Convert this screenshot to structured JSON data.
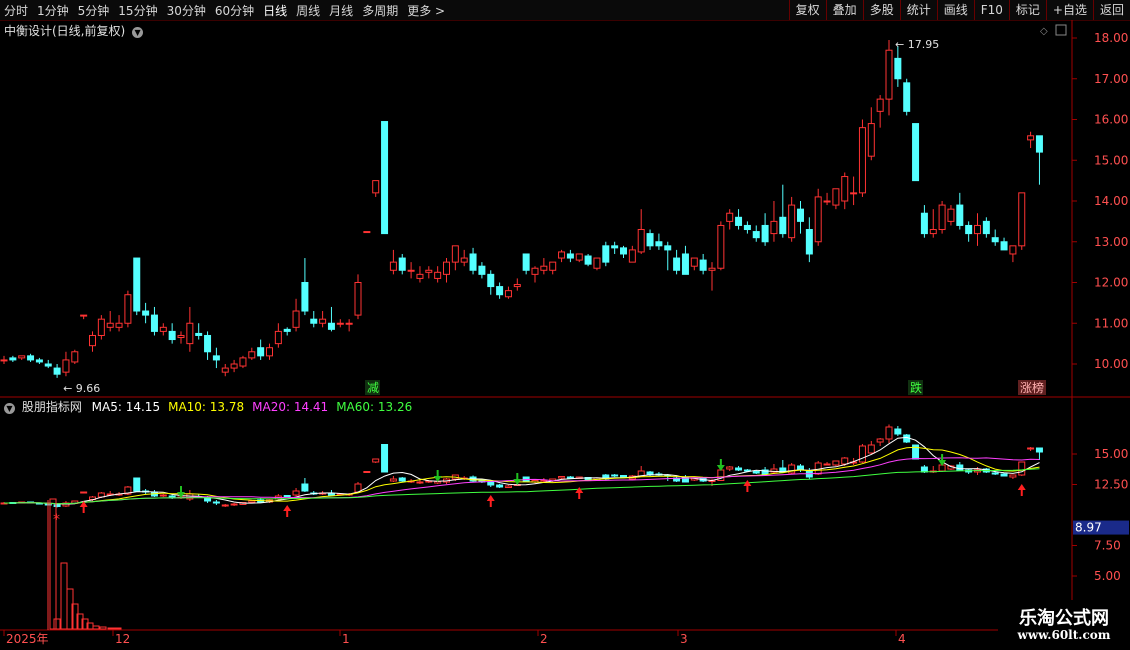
{
  "toolbar": {
    "periods": [
      "分时",
      "1分钟",
      "5分钟",
      "15分钟",
      "30分钟",
      "60分钟",
      "日线",
      "周线",
      "月线",
      "多周期",
      "更多 >"
    ],
    "active_period": "日线",
    "actions": [
      "复权",
      "叠加",
      "多股",
      "统计",
      "画线",
      "F10",
      "标记",
      "+自选",
      "返回"
    ]
  },
  "stock": {
    "title": "中衡设计(日线,前复权)"
  },
  "indicator": {
    "name": "股朋指标网",
    "ma": [
      {
        "label": "MA5: 14.15",
        "color": "#ffffff"
      },
      {
        "label": "MA10: 13.78",
        "color": "#ffff00"
      },
      {
        "label": "MA20: 14.41",
        "color": "#ff40ff"
      },
      {
        "label": "MA60: 13.26",
        "color": "#40ff40"
      }
    ]
  },
  "markers": {
    "jian": "减",
    "die": "跌",
    "zhangting": "涨榜"
  },
  "main_axis": [
    "18.00",
    "17.00",
    "16.00",
    "15.00",
    "14.00",
    "13.00",
    "12.00",
    "11.00",
    "10.00"
  ],
  "sub_axis": [
    "15.00",
    "12.50",
    "7.50",
    "5.00"
  ],
  "sub_current": "8.97",
  "date_labels": [
    "2025年",
    "12",
    "1",
    "2",
    "3",
    "4"
  ],
  "logo": {
    "line1": "乐淘公式网",
    "line2": "www.60lt.com"
  },
  "chart_data": {
    "type": "candlestick",
    "high_label": "17.95",
    "low_label": "9.66",
    "colors": {
      "up": "#ff3333",
      "down": "#54ffff",
      "ma5": "#ffffff",
      "ma10": "#ffff00",
      "ma20": "#ff40ff",
      "ma60": "#40ff40"
    },
    "ohlc": [
      [
        10.1,
        10.2,
        10.0,
        10.1
      ],
      [
        10.15,
        10.2,
        10.05,
        10.1
      ],
      [
        10.15,
        10.2,
        10.1,
        10.2
      ],
      [
        10.2,
        10.25,
        10.05,
        10.1
      ],
      [
        10.1,
        10.15,
        10.0,
        10.05
      ],
      [
        10.0,
        10.1,
        9.9,
        9.95
      ],
      [
        9.9,
        10.0,
        9.66,
        9.75
      ],
      [
        9.8,
        10.3,
        9.7,
        10.1
      ],
      [
        10.05,
        10.35,
        10.0,
        10.3
      ],
      [
        11.2,
        11.2,
        11.1,
        11.2
      ],
      [
        10.45,
        10.8,
        10.3,
        10.7
      ],
      [
        10.7,
        11.2,
        10.6,
        11.1
      ],
      [
        10.9,
        11.3,
        10.8,
        11.0
      ],
      [
        10.9,
        11.2,
        10.8,
        11.0
      ],
      [
        11.0,
        11.8,
        10.9,
        11.7
      ],
      [
        12.6,
        12.6,
        11.2,
        11.3
      ],
      [
        11.3,
        11.5,
        11.0,
        11.2
      ],
      [
        11.2,
        11.4,
        10.7,
        10.8
      ],
      [
        10.8,
        11.0,
        10.7,
        10.9
      ],
      [
        10.8,
        11.0,
        10.5,
        10.6
      ],
      [
        10.65,
        10.8,
        10.5,
        10.7
      ],
      [
        10.5,
        11.4,
        10.3,
        11.0
      ],
      [
        10.75,
        11.0,
        10.6,
        10.7
      ],
      [
        10.7,
        10.8,
        10.1,
        10.3
      ],
      [
        10.2,
        10.4,
        9.9,
        10.1
      ],
      [
        9.8,
        10.0,
        9.7,
        9.9
      ],
      [
        9.9,
        10.1,
        9.8,
        10.0
      ],
      [
        9.95,
        10.2,
        9.9,
        10.15
      ],
      [
        10.15,
        10.4,
        10.1,
        10.3
      ],
      [
        10.4,
        10.6,
        10.1,
        10.2
      ],
      [
        10.2,
        10.5,
        10.1,
        10.4
      ],
      [
        10.5,
        11.0,
        10.4,
        10.8
      ],
      [
        10.85,
        10.9,
        10.7,
        10.8
      ],
      [
        10.9,
        11.6,
        10.8,
        11.3
      ],
      [
        12.0,
        12.6,
        11.2,
        11.3
      ],
      [
        11.1,
        11.3,
        10.9,
        11.0
      ],
      [
        11.0,
        11.3,
        10.9,
        11.1
      ],
      [
        11.0,
        11.4,
        10.8,
        10.85
      ],
      [
        11.0,
        11.1,
        10.9,
        11.0
      ],
      [
        11.0,
        11.1,
        10.8,
        11.0
      ],
      [
        11.2,
        12.2,
        11.1,
        12.0
      ],
      [
        13.25,
        13.25,
        13.25,
        13.25
      ],
      [
        14.2,
        14.5,
        14.1,
        14.5
      ],
      [
        15.95,
        15.95,
        13.2,
        13.2
      ],
      [
        12.3,
        12.8,
        12.2,
        12.5
      ],
      [
        12.6,
        12.7,
        12.2,
        12.3
      ],
      [
        12.3,
        12.5,
        12.1,
        12.3
      ],
      [
        12.1,
        12.4,
        12.0,
        12.2
      ],
      [
        12.25,
        12.4,
        12.1,
        12.3
      ],
      [
        12.1,
        12.4,
        12.0,
        12.25
      ],
      [
        12.2,
        12.6,
        12.0,
        12.5
      ],
      [
        12.5,
        12.8,
        12.3,
        12.9
      ],
      [
        12.5,
        12.8,
        12.4,
        12.6
      ],
      [
        12.7,
        12.85,
        12.2,
        12.3
      ],
      [
        12.4,
        12.5,
        12.1,
        12.2
      ],
      [
        12.2,
        12.3,
        11.7,
        11.9
      ],
      [
        11.9,
        12.0,
        11.6,
        11.7
      ],
      [
        11.65,
        11.9,
        11.6,
        11.8
      ],
      [
        11.9,
        12.1,
        11.8,
        11.95
      ],
      [
        12.7,
        12.7,
        12.2,
        12.3
      ],
      [
        12.2,
        12.4,
        12.0,
        12.35
      ],
      [
        12.3,
        12.6,
        12.2,
        12.4
      ],
      [
        12.3,
        12.5,
        12.2,
        12.5
      ],
      [
        12.6,
        12.8,
        12.5,
        12.75
      ],
      [
        12.7,
        12.8,
        12.5,
        12.6
      ],
      [
        12.55,
        12.7,
        12.5,
        12.7
      ],
      [
        12.65,
        12.7,
        12.4,
        12.45
      ],
      [
        12.35,
        12.6,
        12.3,
        12.6
      ],
      [
        12.9,
        13.0,
        12.4,
        12.5
      ],
      [
        12.9,
        13.0,
        12.7,
        12.85
      ],
      [
        12.85,
        12.9,
        12.6,
        12.7
      ],
      [
        12.5,
        12.9,
        12.5,
        12.8
      ],
      [
        12.75,
        13.8,
        12.7,
        13.3
      ],
      [
        13.2,
        13.3,
        12.8,
        12.9
      ],
      [
        13.0,
        13.2,
        12.8,
        12.9
      ],
      [
        12.9,
        13.0,
        12.3,
        12.8
      ],
      [
        12.6,
        12.8,
        12.2,
        12.3
      ],
      [
        12.7,
        12.9,
        12.3,
        12.2
      ],
      [
        12.4,
        12.6,
        12.3,
        12.6
      ],
      [
        12.55,
        12.7,
        12.2,
        12.3
      ],
      [
        12.3,
        12.5,
        11.8,
        12.35
      ],
      [
        12.35,
        13.5,
        12.3,
        13.4
      ],
      [
        13.5,
        13.8,
        13.3,
        13.7
      ],
      [
        13.6,
        13.8,
        13.3,
        13.4
      ],
      [
        13.4,
        13.5,
        13.2,
        13.3
      ],
      [
        13.25,
        13.4,
        13.0,
        13.1
      ],
      [
        13.4,
        13.7,
        12.9,
        13.0
      ],
      [
        13.2,
        14.0,
        13.0,
        13.5
      ],
      [
        13.6,
        14.4,
        13.1,
        13.2
      ],
      [
        13.1,
        14.1,
        13.0,
        13.9
      ],
      [
        13.8,
        14.0,
        13.2,
        13.5
      ],
      [
        13.3,
        13.6,
        12.5,
        12.7
      ],
      [
        13.0,
        14.3,
        12.9,
        14.1
      ],
      [
        14.0,
        14.2,
        13.9,
        14.0
      ],
      [
        13.9,
        14.3,
        13.8,
        14.3
      ],
      [
        14.0,
        14.7,
        13.8,
        14.6
      ],
      [
        14.2,
        14.6,
        13.9,
        14.2
      ],
      [
        14.2,
        16.0,
        14.1,
        15.8
      ],
      [
        15.1,
        16.3,
        15.0,
        15.9
      ],
      [
        16.2,
        16.6,
        15.8,
        16.5
      ],
      [
        16.5,
        17.95,
        16.1,
        17.7
      ],
      [
        17.5,
        17.8,
        16.8,
        17.0
      ],
      [
        16.9,
        17.0,
        16.1,
        16.2
      ],
      [
        15.9,
        15.9,
        14.5,
        14.5
      ],
      [
        13.7,
        13.9,
        13.1,
        13.2
      ],
      [
        13.2,
        13.8,
        13.1,
        13.3
      ],
      [
        13.3,
        14.0,
        13.2,
        13.9
      ],
      [
        13.5,
        13.9,
        13.4,
        13.8
      ],
      [
        13.9,
        14.2,
        13.3,
        13.4
      ],
      [
        13.4,
        13.5,
        13.0,
        13.2
      ],
      [
        13.2,
        13.7,
        12.9,
        13.4
      ],
      [
        13.5,
        13.6,
        13.1,
        13.2
      ],
      [
        13.1,
        13.3,
        12.9,
        13.0
      ],
      [
        13.0,
        13.1,
        12.8,
        12.8
      ],
      [
        12.7,
        12.9,
        12.5,
        12.9
      ],
      [
        12.9,
        14.2,
        12.8,
        14.2
      ],
      [
        15.5,
        15.7,
        15.3,
        15.6
      ],
      [
        15.6,
        15.6,
        14.4,
        15.2
      ]
    ]
  }
}
